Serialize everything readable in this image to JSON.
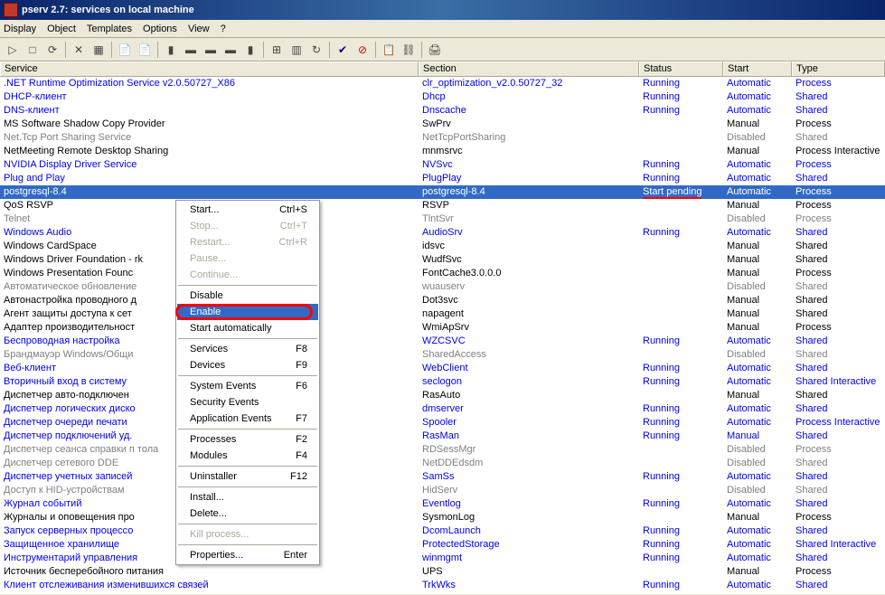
{
  "window": {
    "title": "pserv 2.7: services on local machine"
  },
  "menubar": [
    "Display",
    "Object",
    "Templates",
    "Options",
    "View",
    "?"
  ],
  "columns": {
    "service": "Service",
    "section": "Section",
    "status": "Status",
    "start": "Start",
    "type": "Type"
  },
  "rows": [
    {
      "svc": ".NET Runtime Optimization Service v2.0.50727_X86",
      "sec": "clr_optimization_v2.0.50727_32",
      "stat": "Running",
      "start": "Automatic",
      "type": "Process",
      "cls": "blue"
    },
    {
      "svc": "DHCP-клиент",
      "sec": "Dhcp",
      "stat": "Running",
      "start": "Automatic",
      "type": "Shared",
      "cls": "blue"
    },
    {
      "svc": "DNS-клиент",
      "sec": "Dnscache",
      "stat": "Running",
      "start": "Automatic",
      "type": "Shared",
      "cls": "blue"
    },
    {
      "svc": "MS Software Shadow Copy Provider",
      "sec": "SwPrv",
      "stat": "",
      "start": "Manual",
      "type": "Process",
      "cls": "black"
    },
    {
      "svc": "Net.Tcp Port Sharing Service",
      "sec": "NetTcpPortSharing",
      "stat": "",
      "start": "Disabled",
      "type": "Shared",
      "cls": "gray"
    },
    {
      "svc": "NetMeeting Remote Desktop Sharing",
      "sec": "mnmsrvc",
      "stat": "",
      "start": "Manual",
      "type": "Process Interactive",
      "cls": "black"
    },
    {
      "svc": "NVIDIA Display Driver Service",
      "sec": "NVSvc",
      "stat": "Running",
      "start": "Automatic",
      "type": "Process",
      "cls": "blue"
    },
    {
      "svc": "Plug and Play",
      "sec": "PlugPlay",
      "stat": "Running",
      "start": "Automatic",
      "type": "Shared",
      "cls": "blue"
    },
    {
      "svc": "postgresql-8.4",
      "sec": "postgresql-8.4",
      "stat": "Start pending",
      "start": "Automatic",
      "type": "Process",
      "cls": "blue",
      "sel": true,
      "mark": true
    },
    {
      "svc": "QoS RSVP",
      "sec": "RSVP",
      "stat": "",
      "start": "Manual",
      "type": "Process",
      "cls": "black"
    },
    {
      "svc": "Telnet",
      "sec": "TlntSvr",
      "stat": "",
      "start": "Disabled",
      "type": "Process",
      "cls": "gray"
    },
    {
      "svc": "Windows Audio",
      "sec": "AudioSrv",
      "stat": "Running",
      "start": "Automatic",
      "type": "Shared",
      "cls": "blue"
    },
    {
      "svc": "Windows CardSpace",
      "sec": "idsvc",
      "stat": "",
      "start": "Manual",
      "type": "Shared",
      "cls": "black"
    },
    {
      "svc": "Windows Driver Foundation - rk",
      "sec": "WudfSvc",
      "stat": "",
      "start": "Manual",
      "type": "Shared",
      "cls": "black"
    },
    {
      "svc": "Windows Presentation Founc",
      "sec": "FontCache3.0.0.0",
      "stat": "",
      "start": "Manual",
      "type": "Process",
      "cls": "black"
    },
    {
      "svc": "Автоматическое обновление",
      "sec": "wuauserv",
      "stat": "",
      "start": "Disabled",
      "type": "Shared",
      "cls": "gray"
    },
    {
      "svc": "Автонастройка проводного д",
      "sec": "Dot3svc",
      "stat": "",
      "start": "Manual",
      "type": "Shared",
      "cls": "black"
    },
    {
      "svc": "Агент защиты доступа к сет",
      "sec": "napagent",
      "stat": "",
      "start": "Manual",
      "type": "Shared",
      "cls": "black"
    },
    {
      "svc": "Адаптер производительност",
      "sec": "WmiApSrv",
      "stat": "",
      "start": "Manual",
      "type": "Process",
      "cls": "black"
    },
    {
      "svc": "Беспроводная настройка",
      "sec": "WZCSVC",
      "stat": "Running",
      "start": "Automatic",
      "type": "Shared",
      "cls": "blue"
    },
    {
      "svc": "Брандмауэр Windows/Общи",
      "sec": "SharedAccess",
      "stat": "",
      "start": "Disabled",
      "type": "Shared",
      "cls": "gray"
    },
    {
      "svc": "Веб-клиент",
      "sec": "WebClient",
      "stat": "Running",
      "start": "Automatic",
      "type": "Shared",
      "cls": "blue"
    },
    {
      "svc": "Вторичный вход в систему",
      "sec": "seclogon",
      "stat": "Running",
      "start": "Automatic",
      "type": "Shared Interactive",
      "cls": "blue"
    },
    {
      "svc": "Диспетчер авто-подключен",
      "sec": "RasAuto",
      "stat": "",
      "start": "Manual",
      "type": "Shared",
      "cls": "black"
    },
    {
      "svc": "Диспетчер логических диско",
      "sec": "dmserver",
      "stat": "Running",
      "start": "Automatic",
      "type": "Shared",
      "cls": "blue"
    },
    {
      "svc": "Диспетчер очереди печати",
      "sec": "Spooler",
      "stat": "Running",
      "start": "Automatic",
      "type": "Process Interactive",
      "cls": "blue"
    },
    {
      "svc": "Диспетчер подключений уд.",
      "sec": "RasMan",
      "stat": "Running",
      "start": "Manual",
      "type": "Shared",
      "cls": "blue"
    },
    {
      "svc": "Диспетчер сеанса справки п     тола",
      "sec": "RDSessMgr",
      "stat": "",
      "start": "Disabled",
      "type": "Process",
      "cls": "gray"
    },
    {
      "svc": "Диспетчер сетевого DDE",
      "sec": "NetDDEdsdm",
      "stat": "",
      "start": "Disabled",
      "type": "Shared",
      "cls": "gray"
    },
    {
      "svc": "Диспетчер учетных записей",
      "sec": "SamSs",
      "stat": "Running",
      "start": "Automatic",
      "type": "Shared",
      "cls": "blue"
    },
    {
      "svc": "Доступ к HID-устройствам",
      "sec": "HidServ",
      "stat": "",
      "start": "Disabled",
      "type": "Shared",
      "cls": "gray"
    },
    {
      "svc": "Журнал событий",
      "sec": "Eventlog",
      "stat": "Running",
      "start": "Automatic",
      "type": "Shared",
      "cls": "blue"
    },
    {
      "svc": "Журналы и оповещения про",
      "sec": "SysmonLog",
      "stat": "",
      "start": "Manual",
      "type": "Process",
      "cls": "black"
    },
    {
      "svc": "Запуск серверных процессо",
      "sec": "DcomLaunch",
      "stat": "Running",
      "start": "Automatic",
      "type": "Shared",
      "cls": "blue"
    },
    {
      "svc": "Защищенное хранилище",
      "sec": "ProtectedStorage",
      "stat": "Running",
      "start": "Automatic",
      "type": "Shared Interactive",
      "cls": "blue"
    },
    {
      "svc": "Инструментарий управления",
      "sec": "winmgmt",
      "stat": "Running",
      "start": "Automatic",
      "type": "Shared",
      "cls": "blue"
    },
    {
      "svc": "Источник бесперебойного питания",
      "sec": "UPS",
      "stat": "",
      "start": "Manual",
      "type": "Process",
      "cls": "black"
    },
    {
      "svc": "Клиент отслеживания изменившихся связей",
      "sec": "TrkWks",
      "stat": "Running",
      "start": "Automatic",
      "type": "Shared",
      "cls": "blue"
    }
  ],
  "context_menu": {
    "groups": [
      [
        {
          "label": "Start...",
          "key": "Ctrl+S"
        },
        {
          "label": "Stop...",
          "key": "Ctrl+T",
          "disabled": true
        },
        {
          "label": "Restart...",
          "key": "Ctrl+R",
          "disabled": true
        },
        {
          "label": "Pause...",
          "disabled": true
        },
        {
          "label": "Continue...",
          "disabled": true
        }
      ],
      [
        {
          "label": "Disable"
        },
        {
          "label": "Enable",
          "hover": true
        },
        {
          "label": "Start automatically"
        }
      ],
      [
        {
          "label": "Services",
          "key": "F8"
        },
        {
          "label": "Devices",
          "key": "F9"
        }
      ],
      [
        {
          "label": "System Events",
          "key": "F6"
        },
        {
          "label": "Security Events"
        },
        {
          "label": "Application Events",
          "key": "F7"
        }
      ],
      [
        {
          "label": "Processes",
          "key": "F2"
        },
        {
          "label": "Modules",
          "key": "F4"
        }
      ],
      [
        {
          "label": "Uninstaller",
          "key": "F12"
        }
      ],
      [
        {
          "label": "Install..."
        },
        {
          "label": "Delete..."
        }
      ],
      [
        {
          "label": "Kill process...",
          "disabled": true
        }
      ],
      [
        {
          "label": "Properties...",
          "key": "Enter"
        }
      ]
    ]
  }
}
